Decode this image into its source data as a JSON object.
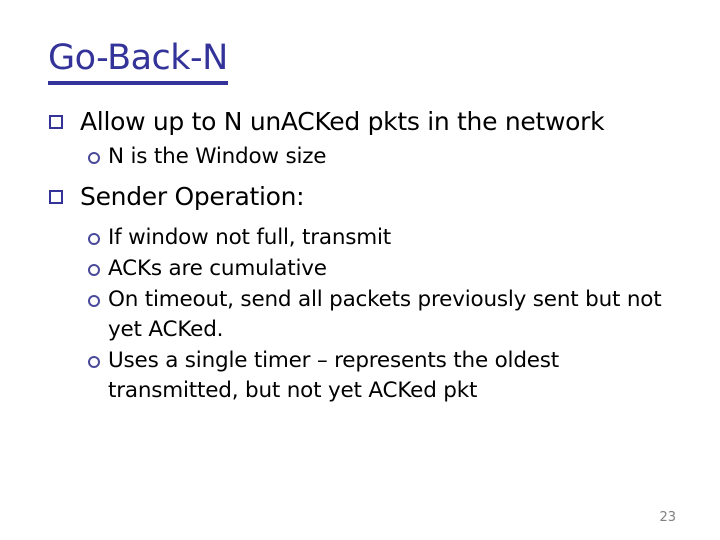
{
  "slide": {
    "title": "Go-Back-N",
    "title_color": "#333399",
    "background_color": "#ffffff",
    "body_text_color": "#000000",
    "bullet_marker_color": "#333399",
    "page_number": "23",
    "page_number_color": "#808080"
  },
  "content": {
    "bullet_1": {
      "marker": "hollow-square",
      "text": "Allow up to N unACKed pkts in the network"
    },
    "bullet_1_sub_1": {
      "marker": "hollow-circle",
      "text": "N is the Window size"
    },
    "bullet_2": {
      "marker": "hollow-square",
      "text": "Sender Operation:"
    },
    "bullet_2_sub_1": {
      "marker": "hollow-circle",
      "text": "If window not full, transmit"
    },
    "bullet_2_sub_2": {
      "marker": "hollow-circle",
      "text": "ACKs are cumulative"
    },
    "bullet_2_sub_3": {
      "marker": "hollow-circle",
      "text": "On timeout, send all packets previously sent but not yet ACKed."
    },
    "bullet_2_sub_4": {
      "marker": "hollow-circle",
      "text": "Uses a single timer – represents the oldest transmitted, but not yet ACKed pkt"
    }
  }
}
